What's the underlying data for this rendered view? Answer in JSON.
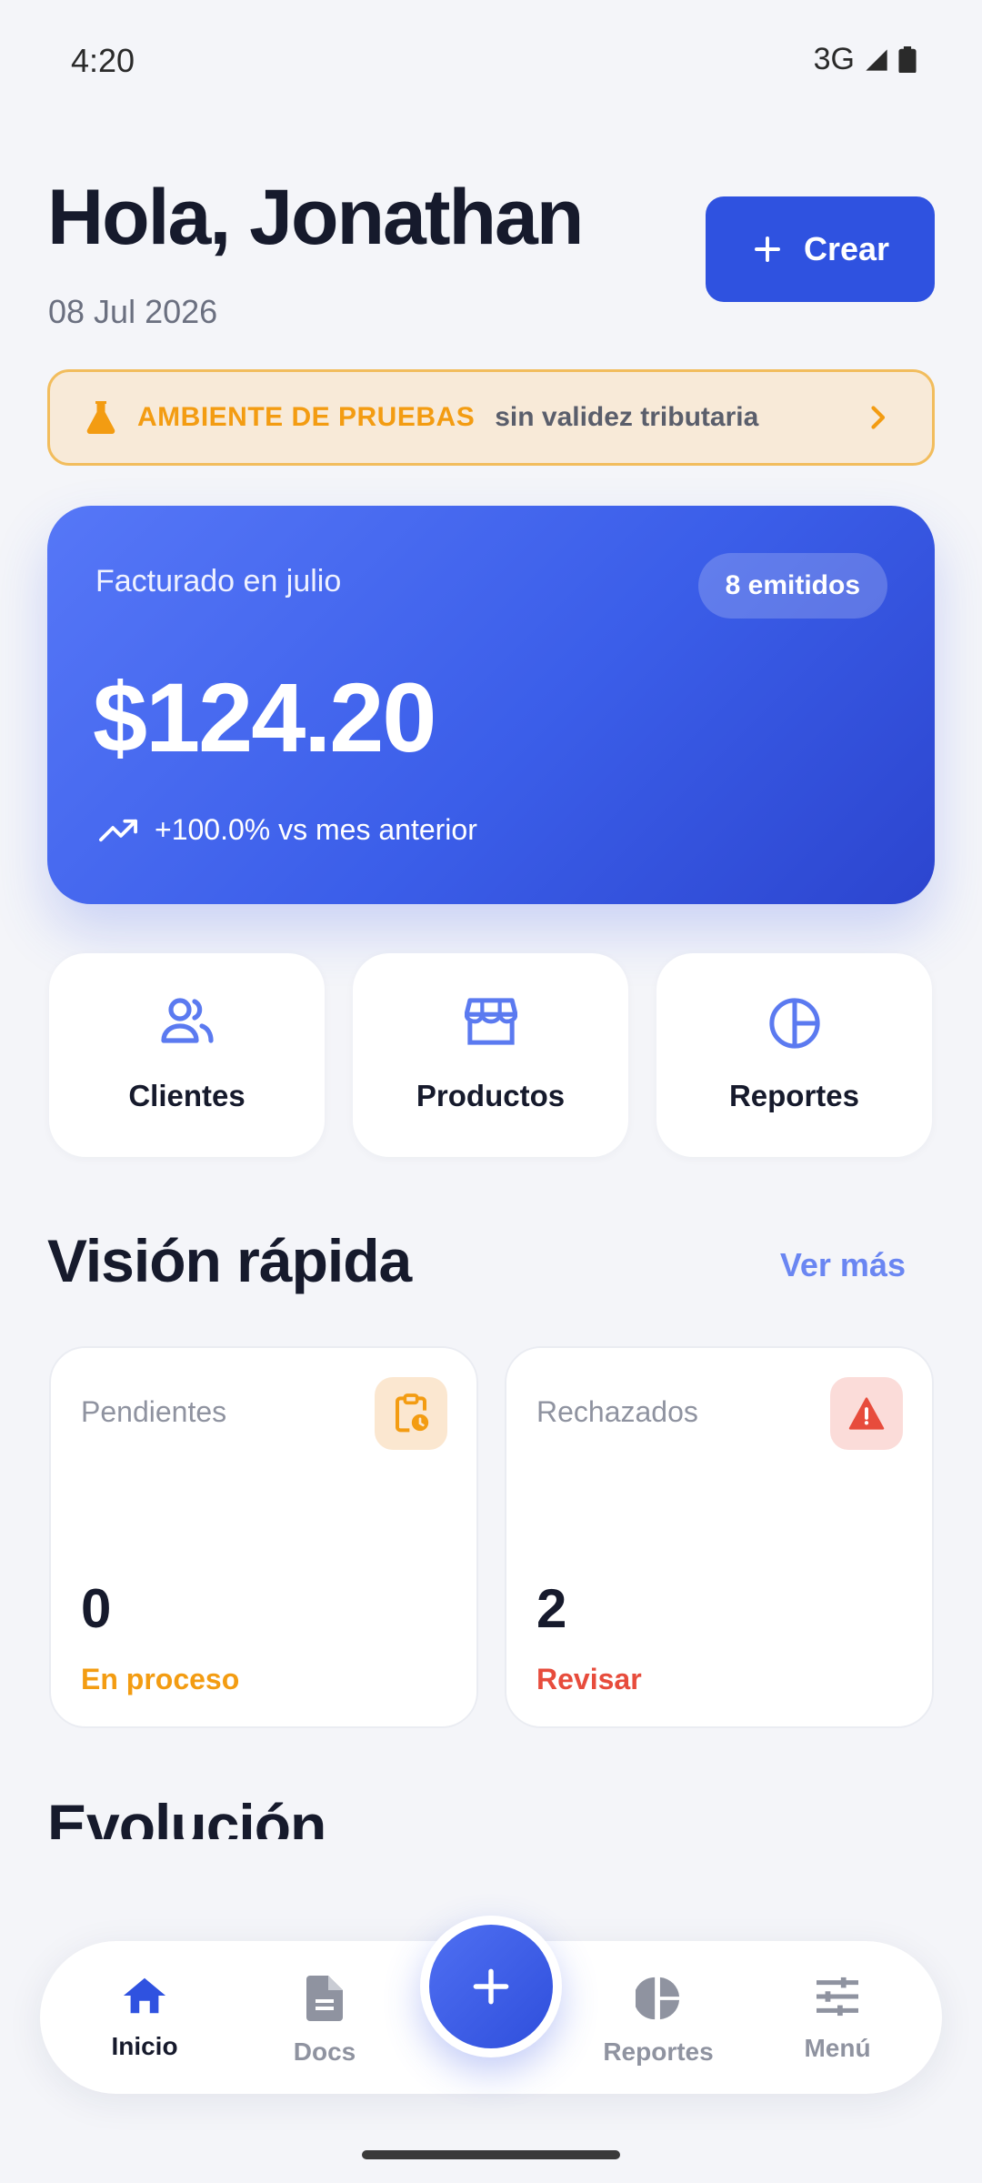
{
  "status_bar": {
    "time": "4:20",
    "network": "3G",
    "icons": [
      "signal-icon",
      "battery-icon"
    ]
  },
  "header": {
    "greeting": "Hola, Jonathan",
    "date": "08 Jul 2026",
    "create_label": "Crear"
  },
  "environment_banner": {
    "title": "AMBIENTE DE PRUEBAS",
    "subtitle": "sin validez tributaria",
    "icon": "flask-icon"
  },
  "summary": {
    "label": "Facturado en julio",
    "badge": "8 emitidos",
    "amount": "$124.20",
    "trend": "+100.0% vs mes anterior"
  },
  "quick_actions": [
    {
      "label": "Clientes",
      "icon": "users-icon"
    },
    {
      "label": "Productos",
      "icon": "store-icon"
    },
    {
      "label": "Reportes",
      "icon": "pie-chart-icon"
    }
  ],
  "overview": {
    "title": "Visión rápida",
    "see_more": "Ver más",
    "cards": [
      {
        "label": "Pendientes",
        "value": "0",
        "status": "En proceso",
        "icon": "clipboard-clock-icon",
        "accent": "#f39c12"
      },
      {
        "label": "Rechazados",
        "value": "2",
        "status": "Revisar",
        "icon": "warning-icon",
        "accent": "#e74c3c"
      }
    ]
  },
  "evolution": {
    "title": "Evolución"
  },
  "bottom_nav": {
    "items": [
      {
        "label": "Inicio",
        "icon": "home-icon",
        "active": true
      },
      {
        "label": "Docs",
        "icon": "document-icon",
        "active": false
      },
      {
        "label": "Reportes",
        "icon": "pie-chart-icon",
        "active": false
      },
      {
        "label": "Menú",
        "icon": "sliders-icon",
        "active": false
      }
    ],
    "fab_icon": "plus-icon"
  },
  "colors": {
    "primary": "#2f52e0",
    "warning": "#f39c12",
    "danger": "#e74c3c",
    "background": "#f4f5f9"
  }
}
